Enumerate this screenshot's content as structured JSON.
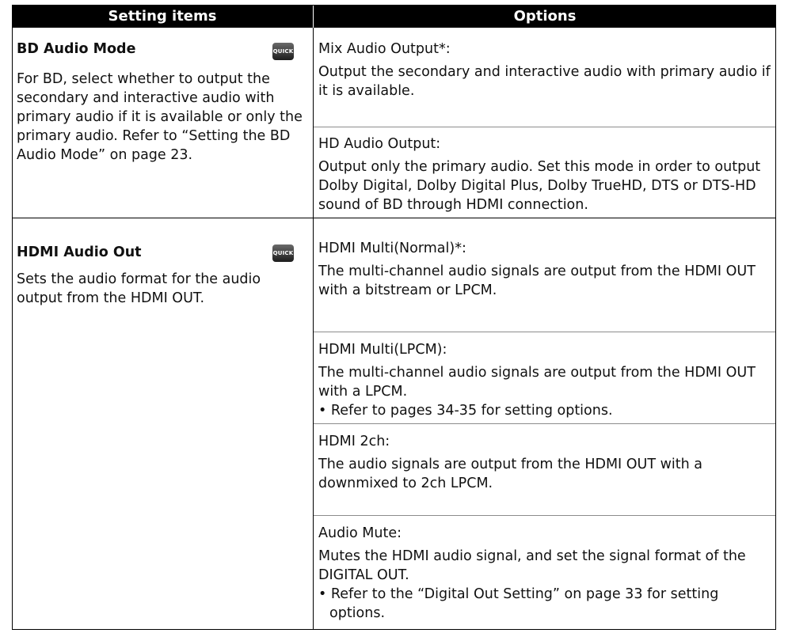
{
  "header": {
    "left": "Setting items",
    "right": "Options"
  },
  "items": [
    {
      "title": "BD Audio Mode",
      "badge": "QUICK",
      "description": "For BD, select whether to output the secondary and interactive audio with primary audio if it is available or only the primary audio. Refer to “Setting the BD Audio Mode” on page 23.",
      "options": [
        {
          "label": "Mix Audio Output*:",
          "description": "Output the secondary and interactive audio with primary audio if it is available."
        },
        {
          "label": "HD Audio Output:",
          "description": "Output only the primary audio. Set this mode in order to output Dolby Digital, Dolby Digital Plus, Dolby TrueHD, DTS or DTS-HD sound of BD through HDMI connection."
        }
      ]
    },
    {
      "title": "HDMI Audio Out",
      "badge": "QUICK",
      "description": "Sets the audio format for the audio output from the HDMI OUT.",
      "options": [
        {
          "label": "HDMI Multi(Normal)*:",
          "description": "The multi-channel audio signals are output from the HDMI OUT with a bitstream or LPCM."
        },
        {
          "label": "HDMI Multi(LPCM):",
          "description": "The multi-channel audio signals are output from the HDMI OUT with a LPCM.",
          "note": "• Refer to pages 34-35 for setting options."
        },
        {
          "label": "HDMI 2ch:",
          "description": "The audio signals are output from the HDMI OUT with a downmixed to 2ch LPCM."
        },
        {
          "label": "Audio Mute:",
          "description": "Mutes the HDMI audio signal, and set the signal format of the DIGITAL OUT.",
          "note": "• Refer to the “Digital Out Setting” on page 33 for setting options."
        }
      ]
    }
  ]
}
